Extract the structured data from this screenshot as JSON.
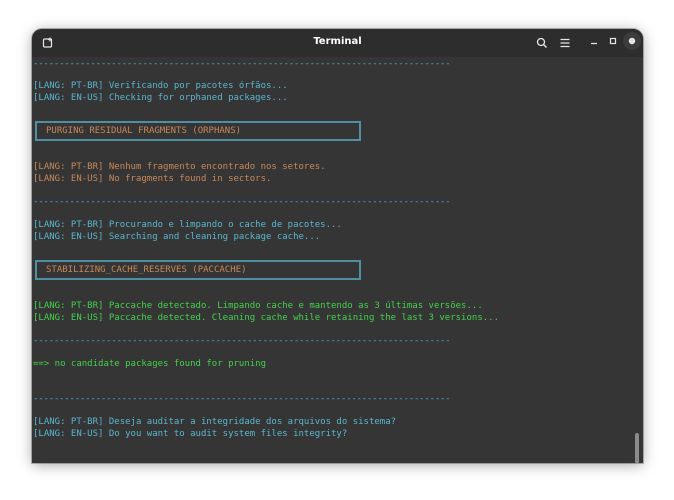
{
  "window": {
    "title": "Terminal"
  },
  "colors": {
    "background": "#353535",
    "cyan": "#5ab7cf",
    "orange": "#c8885a",
    "green": "#43d24c",
    "box_border": "#4e8fa1"
  },
  "icons": {
    "new_tab": "new-tab-icon",
    "search": "search-icon",
    "menu": "hamburger-menu-icon",
    "minimize": "minimize-icon",
    "maximize": "maximize-icon",
    "close": "close-icon"
  },
  "terminal": {
    "separator": "--------------------------------------------------------------------------------",
    "lines": [
      {
        "id": "sep1",
        "kind": "sep"
      },
      {
        "id": "l1",
        "text": "[LANG: PT-BR] Verificando por pacotes órfãos...",
        "color": "cyan"
      },
      {
        "id": "l2",
        "text": "[LANG: EN-US] Checking for orphaned packages...",
        "color": "cyan"
      },
      {
        "id": "box1",
        "kind": "box",
        "text": "PURGING RESIDUAL FRAGMENTS (ORPHANS)"
      },
      {
        "id": "l3",
        "text": "[LANG: PT-BR] Nenhum fragmento encontrado nos setores.",
        "color": "orange"
      },
      {
        "id": "l4",
        "text": "[LANG: EN-US] No fragments found in sectors.",
        "color": "orange"
      },
      {
        "id": "sep2",
        "kind": "sep"
      },
      {
        "id": "l5",
        "text": "[LANG: PT-BR] Procurando e limpando o cache de pacotes...",
        "color": "cyan"
      },
      {
        "id": "l6",
        "text": "[LANG: EN-US] Searching and cleaning package cache...",
        "color": "cyan"
      },
      {
        "id": "box2",
        "kind": "box",
        "text": "STABILIZING_CACHE_RESERVES (PACCACHE)"
      },
      {
        "id": "l7",
        "text": "[LANG: PT-BR] Paccache detectado. Limpando cache e mantendo as 3 últimas versões...",
        "color": "green"
      },
      {
        "id": "l8",
        "text": "[LANG: EN-US] Paccache detected. Cleaning cache while retaining the last 3 versions...",
        "color": "green"
      },
      {
        "id": "sep3",
        "kind": "sep"
      },
      {
        "id": "l9",
        "text": "==> no candidate packages found for pruning",
        "color": "green"
      },
      {
        "id": "sep4",
        "kind": "sep"
      },
      {
        "id": "l10",
        "text": "[LANG: PT-BR] Deseja auditar a integridade dos arquivos do sistema?",
        "color": "cyan"
      },
      {
        "id": "l11",
        "text": "[LANG: EN-US] Do you want to audit system files integrity?",
        "color": "cyan"
      }
    ]
  }
}
